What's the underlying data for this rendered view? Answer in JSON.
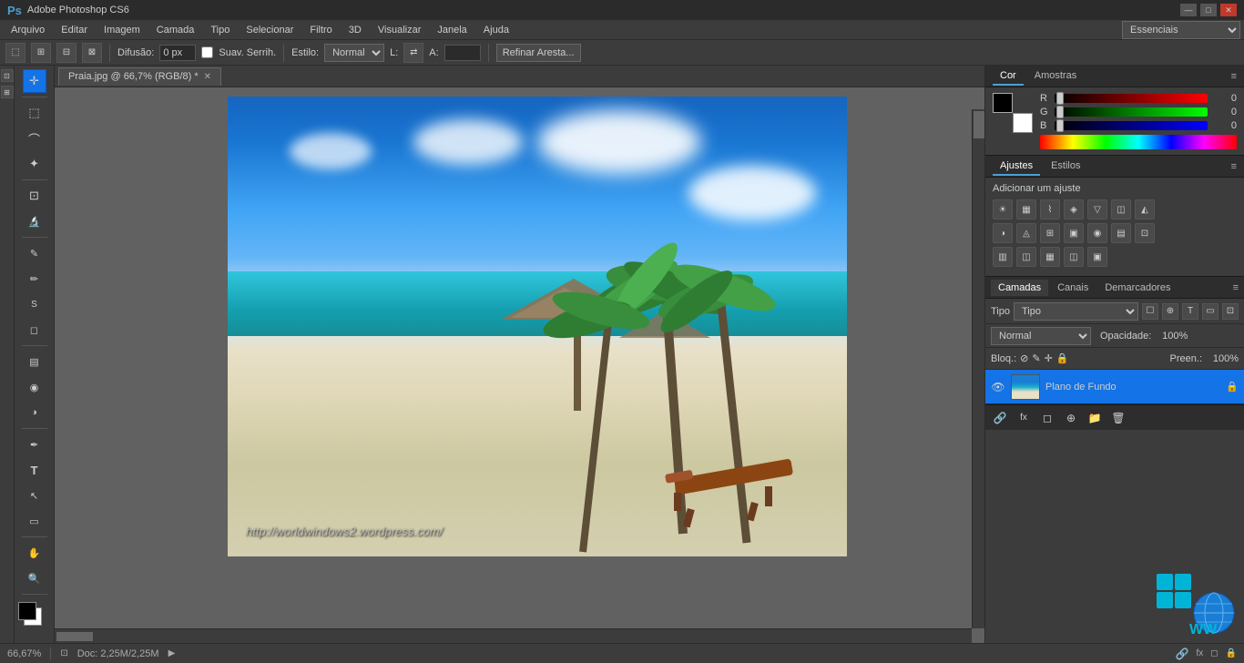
{
  "titlebar": {
    "logo": "Ps",
    "title": "Adobe Photoshop CS6",
    "win_controls": [
      "—",
      "□",
      "✕"
    ]
  },
  "menubar": {
    "items": [
      "Arquivo",
      "Editar",
      "Imagem",
      "Camada",
      "Tipo",
      "Selecionar",
      "Filtro",
      "3D",
      "Visualizar",
      "Janela",
      "Ajuda"
    ]
  },
  "optionsbar": {
    "diffusion_label": "Difusão:",
    "diffusion_value": "0 px",
    "smooth_label": "Suav. Serrih.",
    "style_label": "Estilo:",
    "style_value": "Normal",
    "refine_btn": "Refinar Aresta...",
    "essentials": "Essenciais"
  },
  "document": {
    "tab_name": "Praia.jpg @ 66,7% (RGB/8) *",
    "zoom": "66,67%",
    "doc_size": "Doc: 2,25M/2,25M"
  },
  "toolbar": {
    "tools": [
      {
        "name": "move",
        "icon": "✛"
      },
      {
        "name": "rect-select",
        "icon": "⬚"
      },
      {
        "name": "lasso",
        "icon": "⌒"
      },
      {
        "name": "magic-wand",
        "icon": "✦"
      },
      {
        "name": "crop",
        "icon": "⊡"
      },
      {
        "name": "eyedropper",
        "icon": "/"
      },
      {
        "name": "spot-heal",
        "icon": "✎"
      },
      {
        "name": "brush",
        "icon": "✏"
      },
      {
        "name": "clone",
        "icon": "S"
      },
      {
        "name": "eraser",
        "icon": "◻"
      },
      {
        "name": "gradient",
        "icon": "▤"
      },
      {
        "name": "blur",
        "icon": "◉"
      },
      {
        "name": "dodge",
        "icon": "◑"
      },
      {
        "name": "pen",
        "icon": "✒"
      },
      {
        "name": "type",
        "icon": "T"
      },
      {
        "name": "path-select",
        "icon": "↖"
      },
      {
        "name": "shape",
        "icon": "▭"
      },
      {
        "name": "hand",
        "icon": "✋"
      },
      {
        "name": "zoom",
        "icon": "🔍"
      }
    ]
  },
  "color_panel": {
    "tab_cor": "Cor",
    "tab_amostras": "Amostras",
    "r_label": "R",
    "g_label": "G",
    "b_label": "B",
    "r_value": "0",
    "g_value": "0",
    "b_value": "0"
  },
  "adjustments_panel": {
    "tab_ajustes": "Ajustes",
    "tab_estilos": "Estilos",
    "title": "Adicionar um ajuste"
  },
  "layers_panel": {
    "tab_camadas": "Camadas",
    "tab_canais": "Canais",
    "tab_demarcadores": "Demarcadores",
    "filter_label": "Tipo",
    "mode_label": "Normal",
    "opacity_label": "Opacidade:",
    "opacity_value": "100%",
    "lock_label": "Bloq.:",
    "fill_label": "Preen.:",
    "fill_value": "100%",
    "layer_name": "Plano de Fundo",
    "bottom_btns": [
      "🔗",
      "fx",
      "◻",
      "⊕",
      "📁",
      "🗑"
    ]
  },
  "statusbar": {
    "zoom": "66,67%",
    "doc_info": "Doc: 2,25M/2,25M"
  },
  "watermark": {
    "url": "http://worldwindows2.wordpress.com/"
  }
}
